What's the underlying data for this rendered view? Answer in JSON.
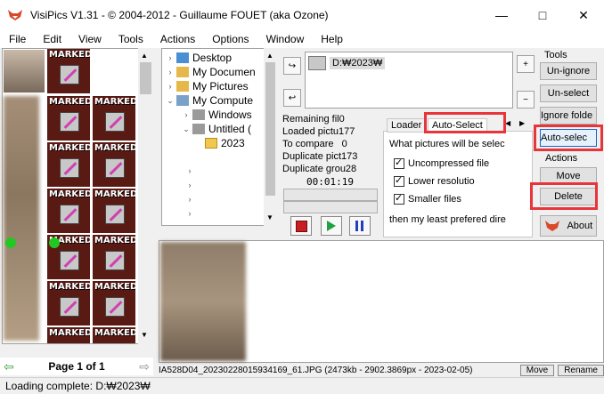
{
  "window": {
    "title": "VisiPics V1.31 - © 2004-2012 - Guillaume FOUET (aka Ozone)",
    "min_icon": "—",
    "max_icon": "□",
    "close_icon": "✕"
  },
  "menu": [
    "File",
    "Edit",
    "View",
    "Tools",
    "Actions",
    "Options",
    "Window",
    "Help"
  ],
  "thumbnails": {
    "marked_label": "MARKED"
  },
  "tree": {
    "items": [
      "Desktop",
      "My Documen",
      "My Pictures",
      "My Compute",
      "Windows",
      "Untitled (",
      "2023"
    ]
  },
  "folders": {
    "entry": "D:₩2023₩",
    "add_icon": "+",
    "remove_icon": "−"
  },
  "stats": {
    "remaining": "Remaining fil0",
    "loaded": "Loaded pictu177",
    "to_compare": "To compare   0",
    "duplicate_pics": "Duplicate pict173",
    "duplicate_groups": "Duplicate grou28",
    "timer": "00:01:19"
  },
  "tabs": {
    "loader": "Loader",
    "auto_select": "Auto-Select",
    "question": "What pictures will be selec",
    "options": [
      "Uncompressed file",
      "Lower resolutio",
      "Smaller files"
    ],
    "footer": "then my least prefered dire"
  },
  "right_panel": {
    "tools_label": "Tools",
    "unignore": "Un-ignore",
    "unselect": "Un-select",
    "ignore_folder": "Ignore folde",
    "auto_select": "Auto-selec",
    "actions_label": "Actions",
    "move": "Move",
    "delete": "Delete",
    "about": "About"
  },
  "preview": {
    "info": "IA528D04_20230228015934169_61.JPG (2473kb - 2902.3869px - 2023-02-05)",
    "move": "Move",
    "rename": "Rename"
  },
  "nav": {
    "page": "Page 1 of 1"
  },
  "status": "Loading complete: D:₩2023₩",
  "colors": {
    "highlight": "#e8353a",
    "selected_blue": "#1e64c8"
  }
}
